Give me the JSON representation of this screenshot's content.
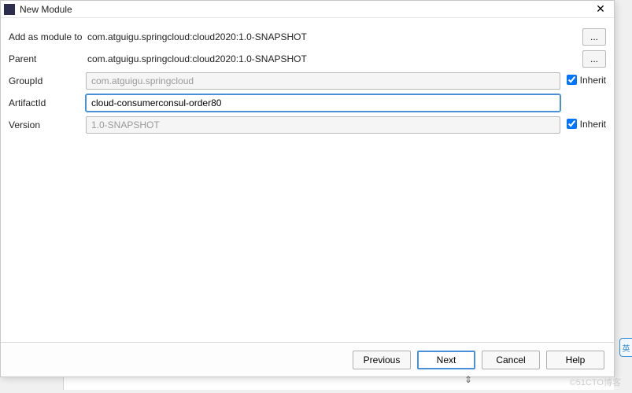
{
  "window": {
    "title": "New Module"
  },
  "form": {
    "addAsModuleTo": {
      "label": "Add as module to",
      "value": "com.atguigu.springcloud:cloud2020:1.0-SNAPSHOT"
    },
    "parent": {
      "label": "Parent",
      "value": "com.atguigu.springcloud:cloud2020:1.0-SNAPSHOT"
    },
    "groupId": {
      "label": "GroupId",
      "value": "com.atguigu.springcloud",
      "inheritLabel": "Inherit",
      "inheritChecked": true
    },
    "artifactId": {
      "label": "ArtifactId",
      "value": "cloud-consumerconsul-order80"
    },
    "version": {
      "label": "Version",
      "value": "1.0-SNAPSHOT",
      "inheritLabel": "Inherit",
      "inheritChecked": true
    }
  },
  "buttons": {
    "previous": "Previous",
    "next": "Next",
    "cancel": "Cancel",
    "help": "Help",
    "browse": "..."
  },
  "watermark": "©51CTO博客",
  "sideWidget": "英"
}
